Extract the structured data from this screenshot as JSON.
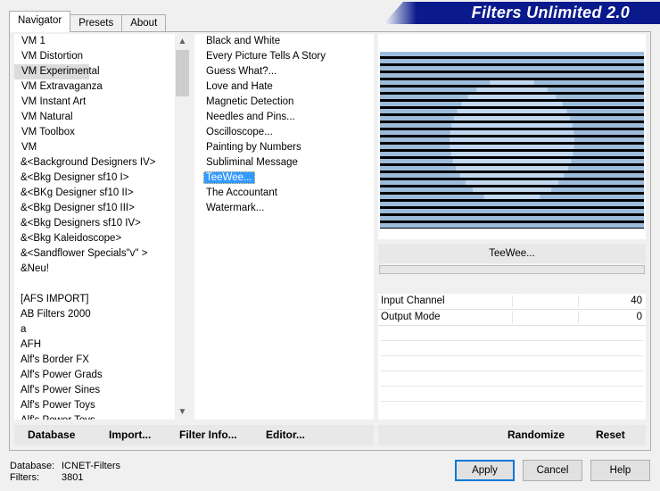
{
  "tabs": [
    {
      "label": "Navigator",
      "active": true
    },
    {
      "label": "Presets",
      "active": false
    },
    {
      "label": "About",
      "active": false
    }
  ],
  "title": "Filters Unlimited 2.0",
  "categories": [
    "VM 1",
    "VM Distortion",
    "VM Experimental",
    "VM Extravaganza",
    "VM Instant Art",
    "VM Natural",
    "VM Toolbox",
    "VM",
    "&<Background Designers IV>",
    "&<Bkg Designer sf10 I>",
    "&<BKg Designer sf10 II>",
    "&<Bkg Designer sf10 III>",
    "&<Bkg Designers sf10 IV>",
    "&<Bkg Kaleidoscope>",
    "&<Sandflower Specials\"v\" >",
    "&Neu!",
    "",
    "[AFS IMPORT]",
    "AB Filters 2000",
    "a",
    "AFH",
    "Alf's Border FX",
    "Alf's Power Grads",
    "Alf's Power Sines",
    "Alf's Power Toys",
    "Alf's Power Toys"
  ],
  "selected_category": "VM Experimental",
  "filters": [
    "Black and White",
    "Every Picture Tells A Story",
    "Guess  What?...",
    "Love and Hate",
    "Magnetic Detection",
    "Needles and Pins...",
    "Oscilloscope...",
    "Painting by Numbers",
    "Subliminal Message",
    "TeeWee...",
    "The Accountant",
    "Watermark..."
  ],
  "selected_filter": "TeeWee...",
  "filter_name": "TeeWee...",
  "params": [
    {
      "name": "Input Channel",
      "value": "40"
    },
    {
      "name": "Output Mode",
      "value": "0"
    }
  ],
  "buttons": {
    "database": "Database",
    "import": "Import...",
    "filter_info": "Filter Info...",
    "editor": "Editor...",
    "randomize": "Randomize",
    "reset": "Reset",
    "apply": "Apply",
    "cancel": "Cancel",
    "help": "Help"
  },
  "status": {
    "database_label": "Database:",
    "database_value": "ICNET-Filters",
    "filters_label": "Filters:",
    "filters_value": "3801"
  },
  "colors": {
    "title_banner": "#0a1a8c",
    "selection": "#3399ff",
    "preview_stripe_light": "#9dbcdc",
    "preview_stripe_dark": "#000000",
    "preview_circle": "#c2d8ef"
  }
}
